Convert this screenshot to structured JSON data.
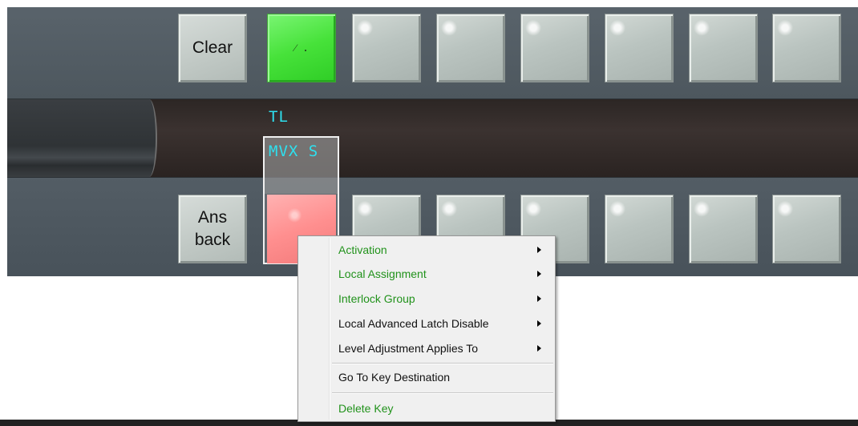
{
  "top_row": {
    "clear_label": "Clear",
    "active_key_text": "⁄ ."
  },
  "label_strip": {
    "line1": "TL",
    "line2": "MVX  S"
  },
  "bottom_row": {
    "ans_line1": "Ans",
    "ans_line2": "back"
  },
  "context_menu": {
    "items": [
      {
        "label": "Activation",
        "submenu": true
      },
      {
        "label": "Local Assignment",
        "submenu": true
      },
      {
        "label": "Interlock Group",
        "submenu": true
      },
      {
        "label": "Local Advanced Latch Disable",
        "submenu": true
      },
      {
        "label": "Level Adjustment Applies To",
        "submenu": true
      },
      {
        "label": "Go To Key Destination",
        "submenu": false
      },
      {
        "label": "Delete Key",
        "submenu": false
      }
    ]
  },
  "colors": {
    "active_key": "#47e23a",
    "selected_key": "#ff8f8f",
    "label_text": "#2ee0ef",
    "menu_green": "#21921b"
  }
}
